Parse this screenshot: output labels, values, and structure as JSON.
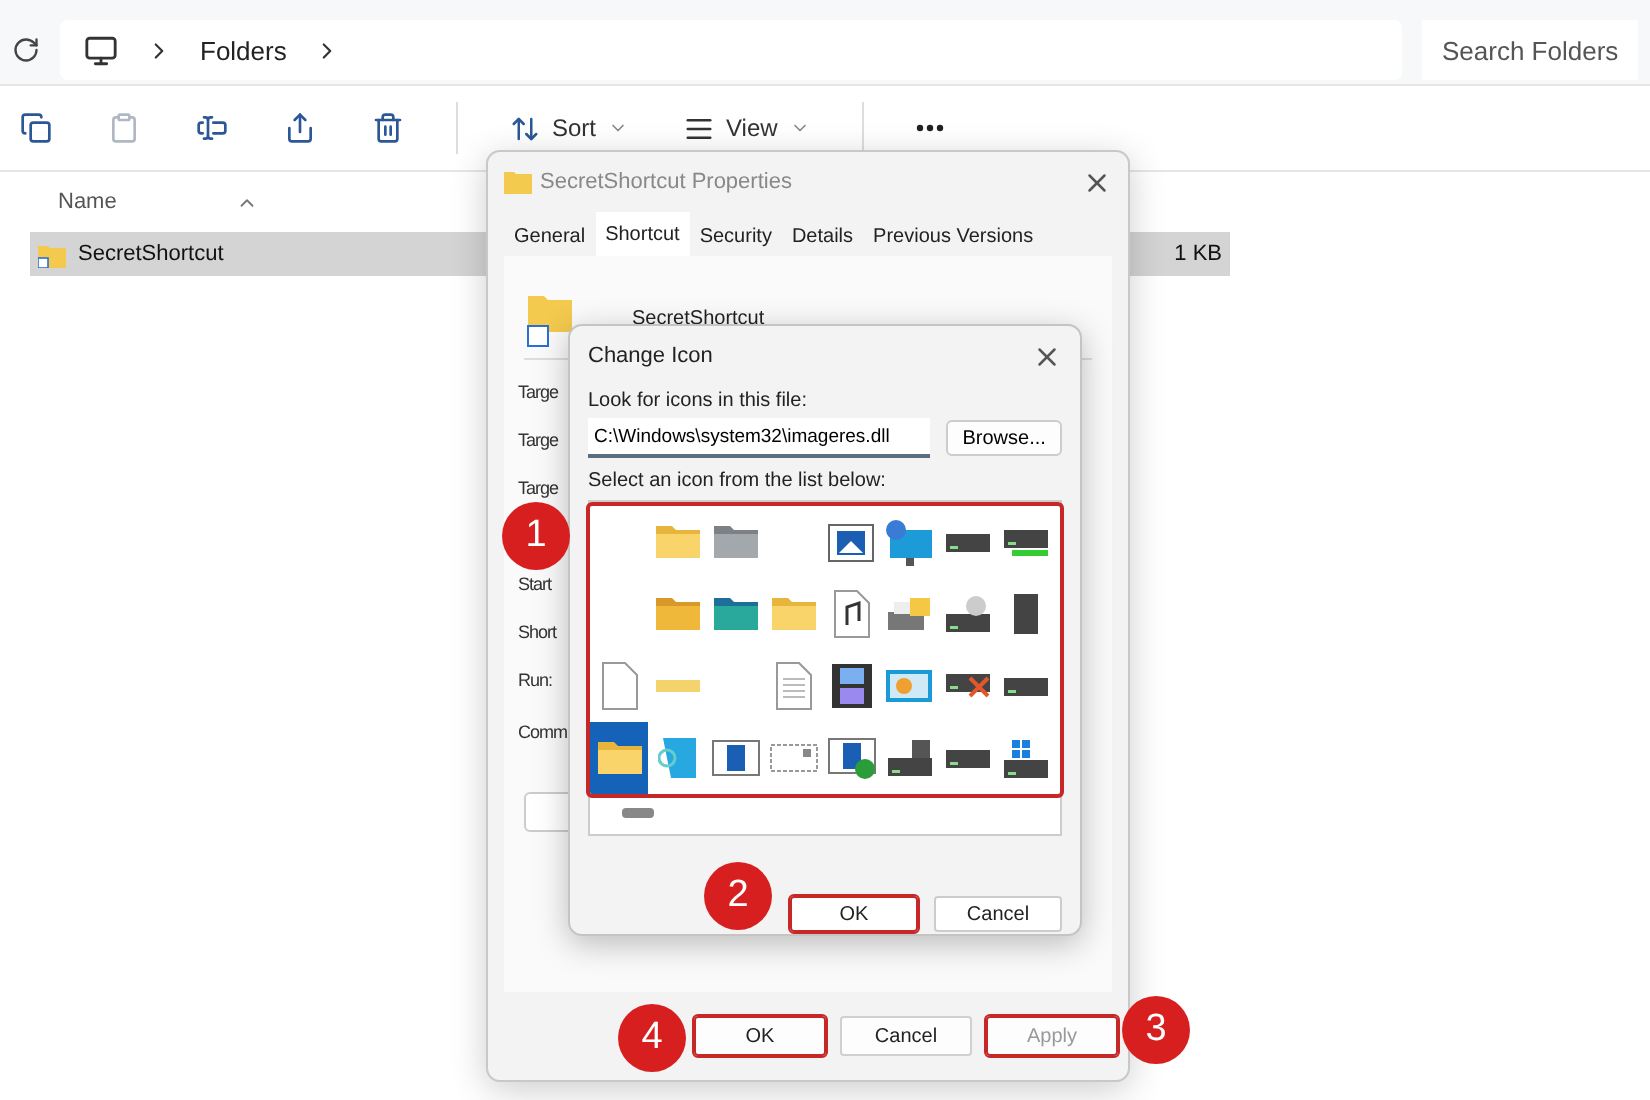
{
  "explorer": {
    "breadcrumb": [
      "Folders"
    ],
    "search": {
      "placeholder": "Search Folders"
    },
    "toolbar": [
      {
        "kind": "copy",
        "disabled": false
      },
      {
        "kind": "paste",
        "disabled": true
      },
      {
        "kind": "rename",
        "disabled": false
      },
      {
        "kind": "share",
        "disabled": false
      },
      {
        "kind": "delete",
        "disabled": false
      }
    ],
    "sort": "Sort",
    "view": "View",
    "columns": [
      "Name"
    ],
    "rows": [
      {
        "name": "SecretShortcut",
        "size": "1 KB",
        "selected": true
      }
    ]
  },
  "properties": {
    "title": "SecretShortcut Properties",
    "tabs": [
      {
        "label": "General",
        "selected": false
      },
      {
        "label": "Shortcut",
        "selected": true
      },
      {
        "label": "Security",
        "selected": false
      },
      {
        "label": "Details",
        "selected": false
      },
      {
        "label": "Previous Versions",
        "selected": false
      }
    ],
    "name": "SecretShortcut",
    "labels": [
      "Targe",
      "Targe",
      "Targe",
      "Start",
      "Short",
      "Run:",
      "Comm"
    ],
    "buttons": [
      {
        "label": "OK",
        "disabled": false,
        "highlighted": true
      },
      {
        "label": "Cancel",
        "disabled": false,
        "highlighted": false
      },
      {
        "label": "Apply",
        "disabled": true,
        "highlighted": true
      }
    ]
  },
  "change_icon": {
    "title": "Change Icon",
    "file_label": "Look for icons in this file:",
    "file_value": "C:\\Windows\\system32\\imageres.dll",
    "browse": "Browse...",
    "list_label": "Select an icon from the list below:",
    "list_highlighted": true,
    "icons": [
      {
        "kind": "blank",
        "selected": false
      },
      {
        "kind": "folder",
        "selected": false
      },
      {
        "kind": "folder-gray",
        "selected": false
      },
      {
        "kind": "blank",
        "selected": false
      },
      {
        "kind": "picture",
        "selected": false
      },
      {
        "kind": "monitor",
        "selected": false
      },
      {
        "kind": "drive",
        "selected": false
      },
      {
        "kind": "drive-green",
        "selected": false
      },
      {
        "kind": "blank",
        "selected": false
      },
      {
        "kind": "folder-orange",
        "selected": false
      },
      {
        "kind": "folder-teal",
        "selected": false
      },
      {
        "kind": "folder",
        "selected": false
      },
      {
        "kind": "music",
        "selected": false
      },
      {
        "kind": "printer",
        "selected": false
      },
      {
        "kind": "drive-disc",
        "selected": false
      },
      {
        "kind": "chip",
        "selected": false
      },
      {
        "kind": "page",
        "selected": false
      },
      {
        "kind": "folder-flat",
        "selected": false
      },
      {
        "kind": "blank",
        "selected": false
      },
      {
        "kind": "lined-page",
        "selected": false
      },
      {
        "kind": "film",
        "selected": false
      },
      {
        "kind": "chart",
        "selected": false
      },
      {
        "kind": "drive-x",
        "selected": false
      },
      {
        "kind": "drive",
        "selected": false
      },
      {
        "kind": "folder",
        "selected": true
      },
      {
        "kind": "magnifier",
        "selected": false
      },
      {
        "kind": "window-doc",
        "selected": false
      },
      {
        "kind": "mail",
        "selected": false
      },
      {
        "kind": "window-check",
        "selected": false
      },
      {
        "kind": "drive-floppy",
        "selected": false
      },
      {
        "kind": "drive",
        "selected": false
      },
      {
        "kind": "drive-win",
        "selected": false
      }
    ],
    "buttons": [
      {
        "label": "OK",
        "highlighted": true
      },
      {
        "label": "Cancel",
        "highlighted": false
      }
    ]
  },
  "callouts": [
    {
      "number": "1"
    },
    {
      "number": "2"
    },
    {
      "number": "3"
    },
    {
      "number": "4"
    }
  ]
}
